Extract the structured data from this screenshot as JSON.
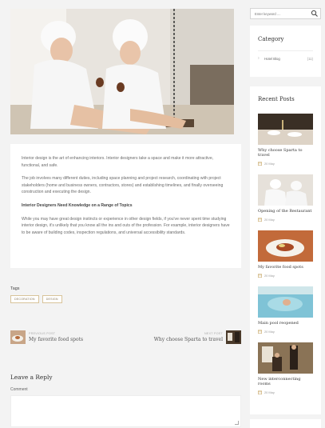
{
  "article": {
    "p1": "Interior design is the art of enhancing interiors. Interior designers take a space and make it more attractive, functional, and safe.",
    "p2": "The job involves many different duties, including space planning and project research, coordinating with project stakeholders (home and business owners, contractors, stores) and establishing timelines, and finally overseeing construction and executing the design.",
    "subheading": "Interior Designers Need Knowledge on a Range of Topics",
    "p3": "While you may have great design instincts or experience in other design fields, if you've never spent time studying interior design, it's unlikely that you know all the ins and outs of the profession. For example, interior designers have to be aware of building codes, inspection regulations, and universal accessibility standards."
  },
  "tags": {
    "label": "Tags",
    "items": [
      "decoration",
      "design"
    ]
  },
  "post_nav": {
    "prev_label": "PREVIOUS POST",
    "prev_title": "My favorite food spots",
    "next_label": "NEXT POST",
    "next_title": "Why choose Sparta to travel"
  },
  "reply": {
    "title": "Leave a Reply",
    "comment_label": "Comment"
  },
  "sidebar": {
    "search_placeholder": "Enter keyword ....",
    "category": {
      "title": "Category",
      "items": [
        {
          "name": "Hotel Blog",
          "count": "(11)"
        }
      ]
    },
    "recent": {
      "title": "Recent Posts",
      "posts": [
        {
          "title": "Why choose Sparta to travel",
          "date": "20 May"
        },
        {
          "title": "Opening of the Restaurant",
          "date": "20 May"
        },
        {
          "title": "My favorite food spots",
          "date": "20 May"
        },
        {
          "title": "Main pool reopened",
          "date": "20 May"
        },
        {
          "title": "New interconnecting rooms",
          "date": "20 May"
        }
      ]
    }
  },
  "colors": {
    "background": "#f3f3f3",
    "tag_border": "#d8c39a",
    "icon_accent": "#c9a86a"
  }
}
